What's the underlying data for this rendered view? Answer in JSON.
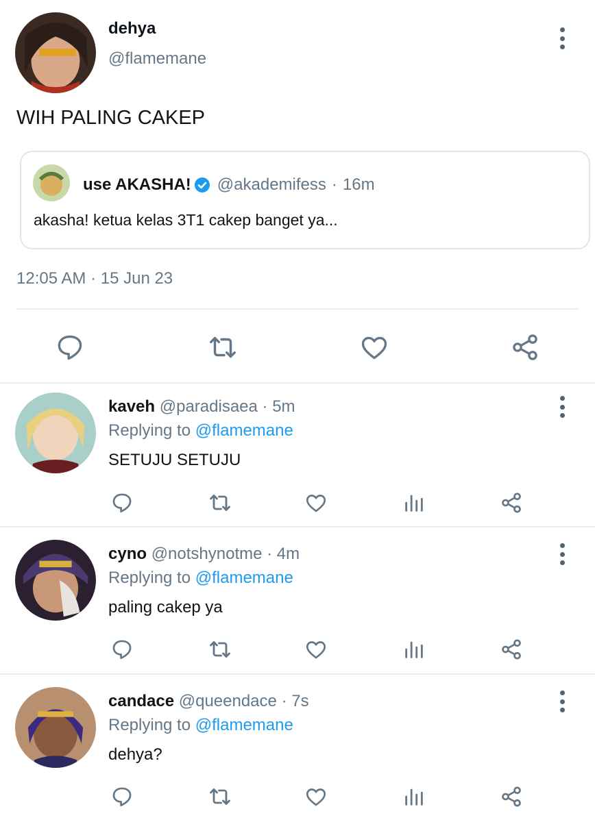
{
  "main_tweet": {
    "name": "dehya",
    "handle": "@flamemane",
    "text": "WIH PALING CAKEP",
    "quote": {
      "name": "use AKASHA!",
      "handle": "@akademifess",
      "separator": "·",
      "time": "16m",
      "text": "akasha! ketua kelas 3T1 cakep banget ya..."
    },
    "timestamp": "12:05 AM · 15 Jun 23"
  },
  "replies": [
    {
      "name": "kaveh",
      "handle": "@paradisaea",
      "time": "· 5m",
      "replying_prefix": "Replying to",
      "replying_to": "@flamemane",
      "text": "SETUJU SETUJU"
    },
    {
      "name": "cyno",
      "handle": "@notshynotme",
      "time": "· 4m",
      "replying_prefix": "Replying to",
      "replying_to": "@flamemane",
      "text": "paling cakep ya"
    },
    {
      "name": "candace",
      "handle": "@queendace",
      "time": "· 7s",
      "replying_prefix": "Replying to",
      "replying_to": "@flamemane",
      "text": "dehya?"
    }
  ],
  "colors": {
    "accent": "#1d9bf0",
    "icon": "#657786",
    "text": "#0f1419",
    "divider": "#e6ecf0"
  },
  "icons": [
    "comment-icon",
    "retweet-icon",
    "like-icon",
    "share-icon",
    "analytics-icon",
    "more-icon",
    "verified-icon"
  ]
}
